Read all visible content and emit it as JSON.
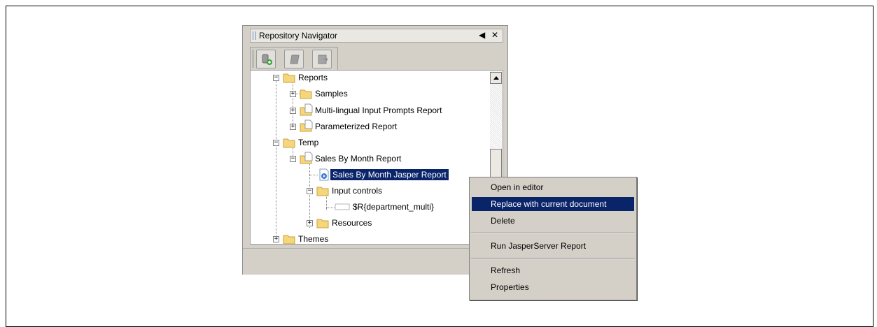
{
  "panel": {
    "title": "Repository Navigator",
    "pin_glyph": "◀",
    "close_glyph": "✕",
    "toolbar": [
      {
        "name": "add-repository-button",
        "icon": "database-add-icon",
        "enabled": true
      },
      {
        "name": "edit-button",
        "icon": "edit-icon",
        "enabled": false
      },
      {
        "name": "export-button",
        "icon": "export-icon",
        "enabled": false
      }
    ]
  },
  "tree": {
    "items": [
      {
        "label": "Reports",
        "depth": 0,
        "type": "folder",
        "expander": "−"
      },
      {
        "label": "Samples",
        "depth": 1,
        "type": "folder",
        "expander": "+"
      },
      {
        "label": "Multi-lingual Input Prompts Report",
        "depth": 1,
        "type": "report-folder",
        "expander": "+"
      },
      {
        "label": "Parameterized Report",
        "depth": 1,
        "type": "report-folder",
        "expander": "+"
      },
      {
        "label": "Temp",
        "depth": 0,
        "type": "folder",
        "expander": "−"
      },
      {
        "label": "Sales By Month Report",
        "depth": 1,
        "type": "report-folder",
        "expander": "−"
      },
      {
        "label": "Sales By Month Jasper Report",
        "depth": 2,
        "type": "jrxml",
        "expander": "",
        "selected": true
      },
      {
        "label": "Input controls",
        "depth": 2,
        "type": "folder",
        "expander": "−"
      },
      {
        "label": "$R{department_multi}",
        "depth": 3,
        "type": "input-control",
        "expander": ""
      },
      {
        "label": "Resources",
        "depth": 2,
        "type": "folder",
        "expander": "+"
      },
      {
        "label": "Themes",
        "depth": 0,
        "type": "folder",
        "expander": "+"
      }
    ]
  },
  "context_menu": {
    "items": [
      {
        "label": "Open in editor"
      },
      {
        "label": "Replace with current document",
        "highlighted": true
      },
      {
        "label": "Delete"
      },
      {
        "label": "Run JasperServer Report"
      },
      {
        "label": "Refresh"
      },
      {
        "label": "Properties"
      }
    ]
  },
  "colors": {
    "selection": "#0a246a",
    "panel_bg": "#d4d0c8",
    "folder": "#f6d67a"
  }
}
